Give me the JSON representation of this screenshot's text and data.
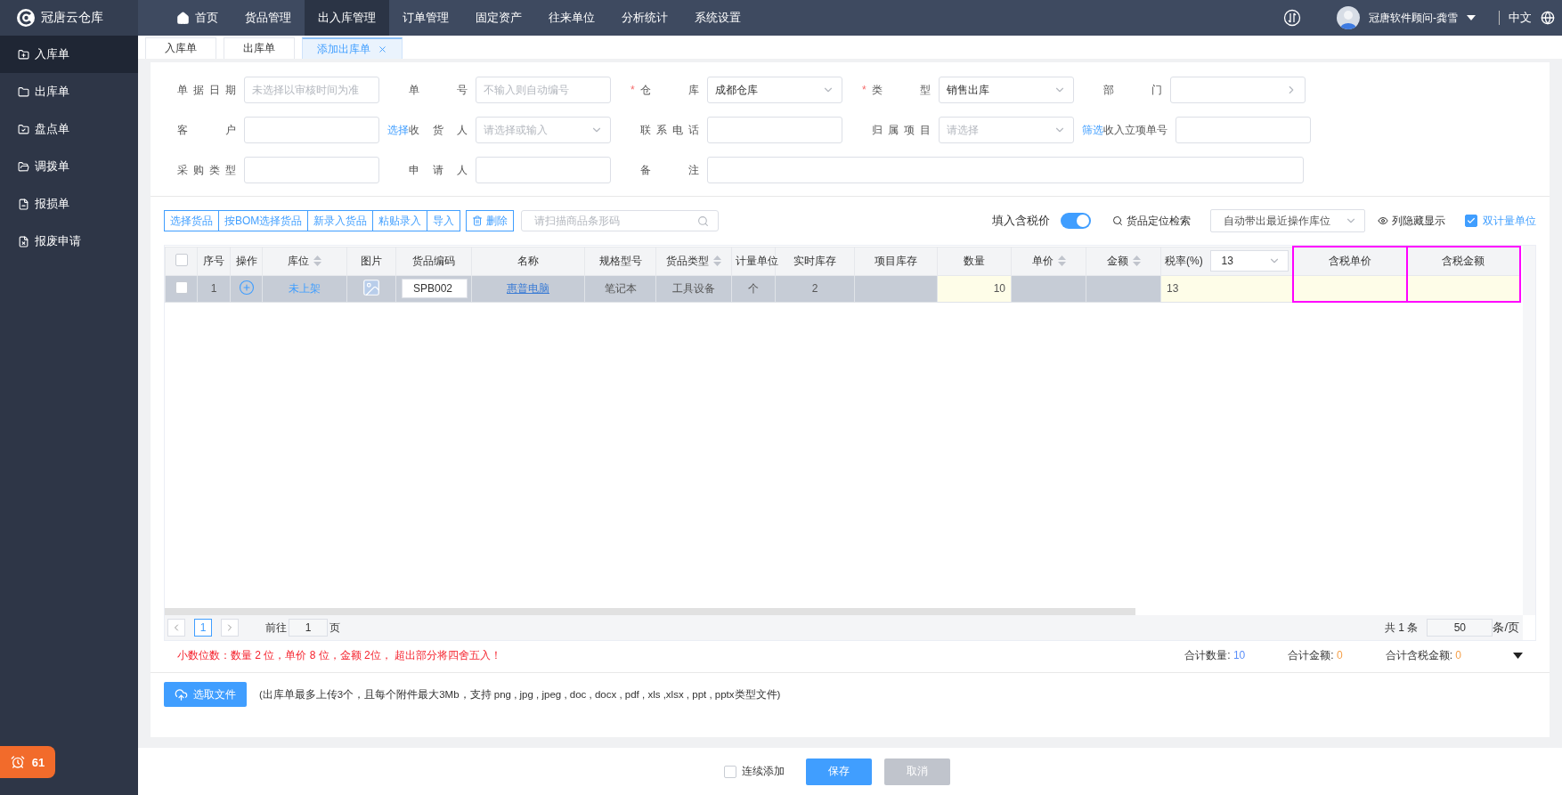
{
  "brand": {
    "name": "冠唐云仓库"
  },
  "nav": [
    {
      "label": "首页",
      "selected": false
    },
    {
      "label": "货品管理",
      "selected": false
    },
    {
      "label": "出入库管理",
      "selected": true
    },
    {
      "label": "订单管理",
      "selected": false
    },
    {
      "label": "固定资产",
      "selected": false
    },
    {
      "label": "往来单位",
      "selected": false
    },
    {
      "label": "分析统计",
      "selected": false
    },
    {
      "label": "系统设置",
      "selected": false
    }
  ],
  "user": {
    "name": "冠唐软件顾问-龚雪",
    "language": "中文"
  },
  "sidebar": {
    "items": [
      {
        "label": "入库单",
        "selected": true
      },
      {
        "label": "出库单",
        "selected": false
      },
      {
        "label": "盘点单",
        "selected": false
      },
      {
        "label": "调拨单",
        "selected": false
      },
      {
        "label": "报损单",
        "selected": false
      },
      {
        "label": "报废申请",
        "selected": false
      }
    ]
  },
  "alert_badge": {
    "count": "61"
  },
  "tabs": [
    {
      "label": "入库单",
      "selected": false,
      "closable": false
    },
    {
      "label": "出库单",
      "selected": false,
      "closable": false
    },
    {
      "label": "添加出库单",
      "selected": true,
      "closable": true
    }
  ],
  "form": {
    "rows": [
      [
        {
          "label": "单据日期",
          "kind": "text",
          "placeholder": "未选择以审核时间为准"
        },
        {
          "label": "单号",
          "kind": "text",
          "placeholder": "不输入则自动编号"
        },
        {
          "label": "仓库",
          "required_mark": "*",
          "kind": "select",
          "value": "成都仓库"
        },
        {
          "label": "类型",
          "required_mark": "*",
          "kind": "select",
          "value": "销售出库"
        },
        {
          "label": "部门",
          "kind": "cascade"
        }
      ],
      [
        {
          "label": "客户",
          "kind": "text",
          "link": "选择"
        },
        {
          "label": "收货人",
          "kind": "select",
          "placeholder": "请选择或输入"
        },
        {
          "label": "联系电话",
          "kind": "text"
        },
        {
          "label": "归属项目",
          "kind": "select",
          "placeholder": "请选择",
          "link": "筛选"
        },
        {
          "label": "收入立项单号",
          "kind": "text"
        }
      ],
      [
        {
          "label": "采购类型",
          "kind": "text"
        },
        {
          "label": "申请人",
          "kind": "text"
        },
        {
          "label": "备注",
          "kind": "text",
          "wide": true
        }
      ]
    ]
  },
  "toolbar": {
    "group_buttons": [
      "选择货品",
      "按BOM选择货品",
      "新录入货品",
      "粘贴录入",
      "导入"
    ],
    "delete_button": "删除",
    "scan_field": {
      "placeholder": "请扫描商品条形码"
    },
    "tax_toggle": {
      "label": "填入含税价",
      "on": true
    },
    "locate_link": "货品定位检索",
    "location_select": {
      "value": "自动带出最近操作库位"
    },
    "columns_link": "列隐藏显示",
    "dual_unit": {
      "label": "双计量单位",
      "checked": true
    }
  },
  "table": {
    "columns": [
      {
        "kind": "checkbox",
        "checked": false
      },
      {
        "label": "序号"
      },
      {
        "label": "操作"
      },
      {
        "label": "库位",
        "sortable": true
      },
      {
        "label": "图片"
      },
      {
        "label": "货品编码"
      },
      {
        "label": "名称"
      },
      {
        "label": "规格型号"
      },
      {
        "label": "货品类型",
        "sortable": true
      },
      {
        "label": "计量单位"
      },
      {
        "label": "实时库存"
      },
      {
        "label": "项目库存"
      },
      {
        "label": "数量"
      },
      {
        "label": "单价",
        "sortable": true
      },
      {
        "label": "金额",
        "sortable": true
      },
      {
        "label": "税率(%)",
        "select": "13"
      },
      {
        "label": "含税单价",
        "highlighted": true
      },
      {
        "label": "含税金额",
        "highlighted": true
      }
    ],
    "rows": [
      {
        "selected": true,
        "checked": false,
        "cells": [
          {
            "kind": "checkbox"
          },
          {
            "kind": "text",
            "text": "1"
          },
          {
            "kind": "add"
          },
          {
            "kind": "link",
            "text": "未上架"
          },
          {
            "kind": "picture"
          },
          {
            "kind": "input",
            "text": "SPB002"
          },
          {
            "kind": "underlined",
            "text": "惠普电脑"
          },
          {
            "kind": "text",
            "text": "笔记本"
          },
          {
            "kind": "text",
            "text": "工具设备"
          },
          {
            "kind": "text",
            "text": "个"
          },
          {
            "kind": "text",
            "text": "2"
          },
          {
            "kind": "text"
          },
          {
            "kind": "editable",
            "text": "10"
          },
          {
            "kind": "text"
          },
          {
            "kind": "text"
          },
          {
            "kind": "editable",
            "text": "13"
          },
          {
            "kind": "editable"
          },
          {
            "kind": "editable"
          }
        ]
      }
    ]
  },
  "pagination": {
    "pages": [
      {
        "label": "1",
        "selected": true
      }
    ],
    "goto_label": "前往",
    "goto_value": "1",
    "page_unit": "页",
    "total": "共 1 条",
    "page_size": "50",
    "page_size_unit": "条/页"
  },
  "precision_note": "小数位数：数量 2 位，单价 8 位，金额 2位， 超出部分将四舍五入！",
  "totals": [
    {
      "label": "合计数量:",
      "value": "10",
      "color": "#5b8ff9"
    },
    {
      "label": "合计金额:",
      "value": "0",
      "color": "#f5a04a"
    },
    {
      "label": "合计含税金额:",
      "value": "0",
      "color": "#f5a04a"
    }
  ],
  "upload": {
    "button": "选取文件",
    "hint": "(出库单最多上传3个，且每个附件最大3Mb，支持 png , jpg , jpeg , doc , docx , pdf , xls ,xlsx , ppt , pptx类型文件)"
  },
  "footer": {
    "continuous_add": {
      "label": "连续添加",
      "checked": false
    },
    "save": {
      "label": "保存",
      "disabled": false
    },
    "cancel": {
      "label": "取消",
      "disabled": true
    }
  }
}
